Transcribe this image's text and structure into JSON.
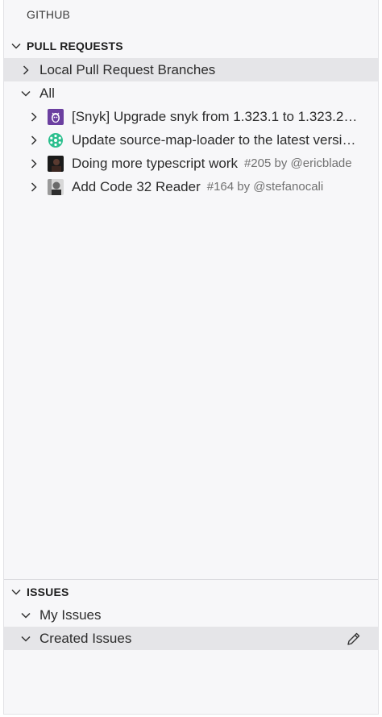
{
  "panel": {
    "title": "GITHUB"
  },
  "pull_requests": {
    "header": "PULL REQUESTS",
    "local_branches": "Local Pull Request Branches",
    "all_label": "All",
    "items": [
      {
        "title": "[Snyk] Upgrade snyk from 1.323.1 to 1.323.2…",
        "meta": "",
        "avatar": "snyk-avatar"
      },
      {
        "title": "Update source-map-loader to the latest versi…",
        "meta": "",
        "avatar": "bot-avatar"
      },
      {
        "title": "Doing more typescript work",
        "meta": "#205 by @ericblade",
        "avatar": "user-avatar"
      },
      {
        "title": "Add Code 32 Reader",
        "meta": "#164 by @stefanocali",
        "avatar": "user-avatar"
      }
    ]
  },
  "issues": {
    "header": "ISSUES",
    "my_issues": "My Issues",
    "created_issues": "Created Issues"
  },
  "colors": {
    "panel_bg": "#f7f7f9",
    "selected_bg": "#e5e5e8",
    "meta_text": "#717171",
    "snyk_purple": "#6b3fa0",
    "bot_green": "#2bbf8e"
  }
}
